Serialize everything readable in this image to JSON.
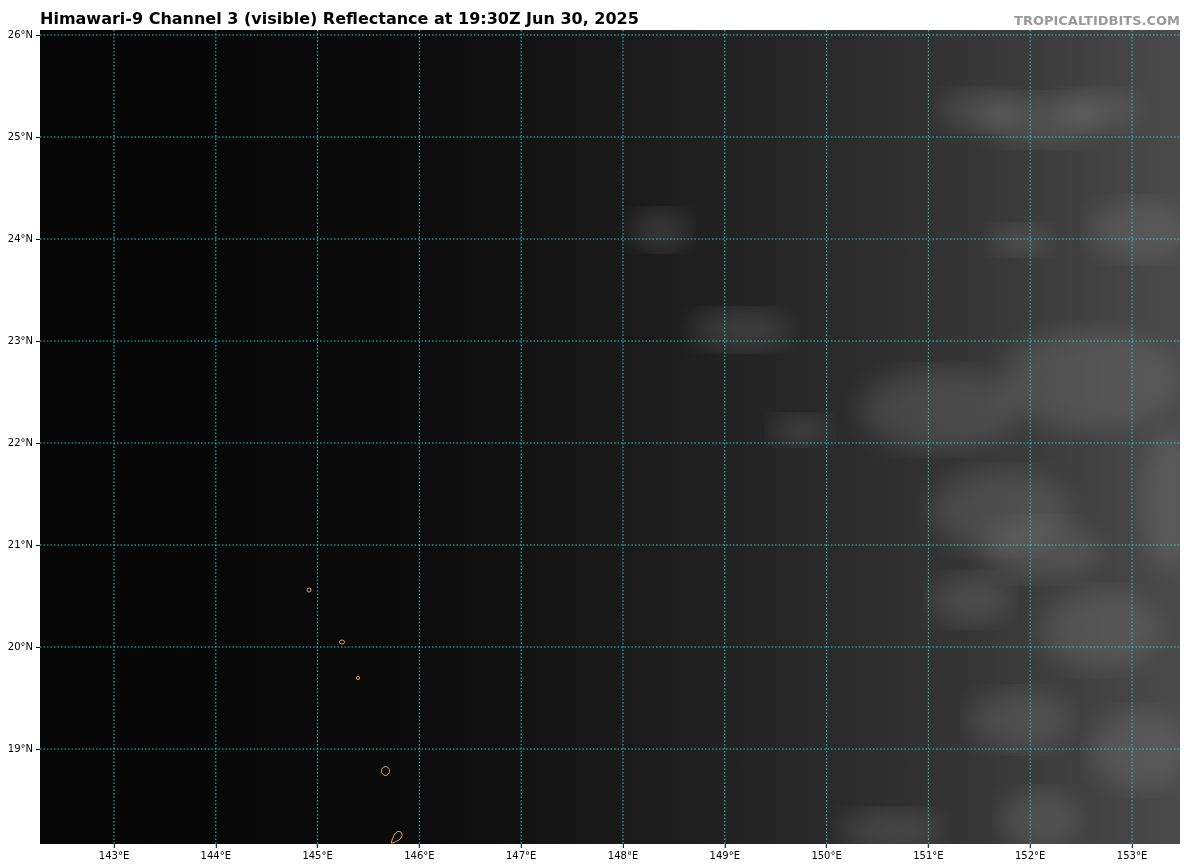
{
  "title": "Himawari-9 Channel 3 (visible) Reflectance at 19:30Z Jun 30, 2025",
  "site_label": "TROPICALTIDBITS.COM",
  "map": {
    "latitude_labels": [
      "26°N",
      "25°N",
      "24°N",
      "23°N",
      "22°N",
      "21°N",
      "20°N",
      "19°N"
    ],
    "longitude_labels": [
      "143°E",
      "144°E",
      "145°E",
      "146°E",
      "147°E",
      "148°E",
      "149°E",
      "150°E",
      "151°E",
      "152°E",
      "153°E"
    ]
  }
}
